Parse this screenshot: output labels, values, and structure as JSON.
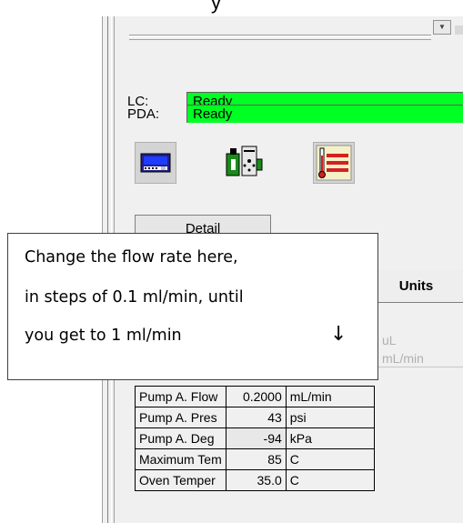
{
  "window": {
    "caption_fragment": "y"
  },
  "status": {
    "lc_label": "LC:",
    "lc_value": "Ready",
    "pda_label": "PDA:",
    "pda_value": "Ready",
    "ready_color": "#00ff22"
  },
  "toolbar_icons": [
    "lc-module-icon",
    "pda-module-icon",
    "column-oven-icon"
  ],
  "detail_button": "Detail",
  "table": {
    "units_header": "Units",
    "partial_rows": [
      {
        "unit": "uL"
      },
      {
        "unit": "mL/min"
      }
    ],
    "rows": [
      {
        "name": "Pump A. Flow",
        "value": "0.2000",
        "unit": "mL/min"
      },
      {
        "name": "Pump A. Pres",
        "value": "43",
        "unit": "psi"
      },
      {
        "name": "Pump A. Deg",
        "value": "-94",
        "unit": "kPa"
      },
      {
        "name": "Maximum Tem",
        "value": "85",
        "unit": "C"
      },
      {
        "name": "Oven Temper",
        "value": "35.0",
        "unit": "C"
      }
    ]
  },
  "callout": {
    "line1": "Change the flow rate here,",
    "line2": "in steps of 0.1 ml/min, until",
    "line3": "you get to 1 ml/min",
    "arrow": "↓"
  }
}
